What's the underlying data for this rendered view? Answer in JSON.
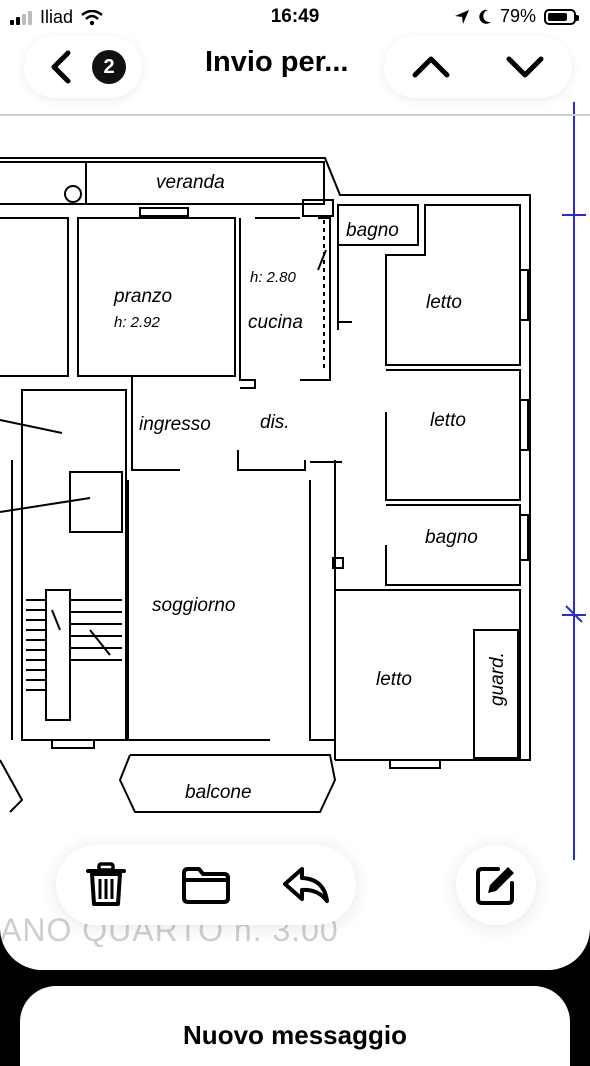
{
  "status_bar": {
    "carrier": "Iliad",
    "time": "16:49",
    "battery_percent": "79%",
    "battery_level": 0.79
  },
  "nav": {
    "back_count": "2",
    "title": "Invio per..."
  },
  "floor_plan": {
    "rooms": {
      "veranda": "veranda",
      "bagno_top": "bagno",
      "pranzo": "pranzo",
      "pranzo_height": "h: 2.92",
      "cucina": "cucina",
      "cucina_height": "h: 2.80",
      "letto_1": "letto",
      "letto_2": "letto",
      "ingresso": "ingresso",
      "dis": "dis.",
      "bagno_mid": "bagno",
      "soggiorno": "soggiorno",
      "letto_3": "letto",
      "guard": "guard.",
      "balcone": "balcone"
    },
    "floor_label": "ANO QUARTO h. 3.00"
  },
  "toolbar": {
    "icons": [
      "trash-icon",
      "folder-icon",
      "reply-icon",
      "compose-icon"
    ]
  },
  "new_message": {
    "title": "Nuovo messaggio"
  },
  "colors": {
    "accent_dim_line": "#2b2bd6"
  }
}
